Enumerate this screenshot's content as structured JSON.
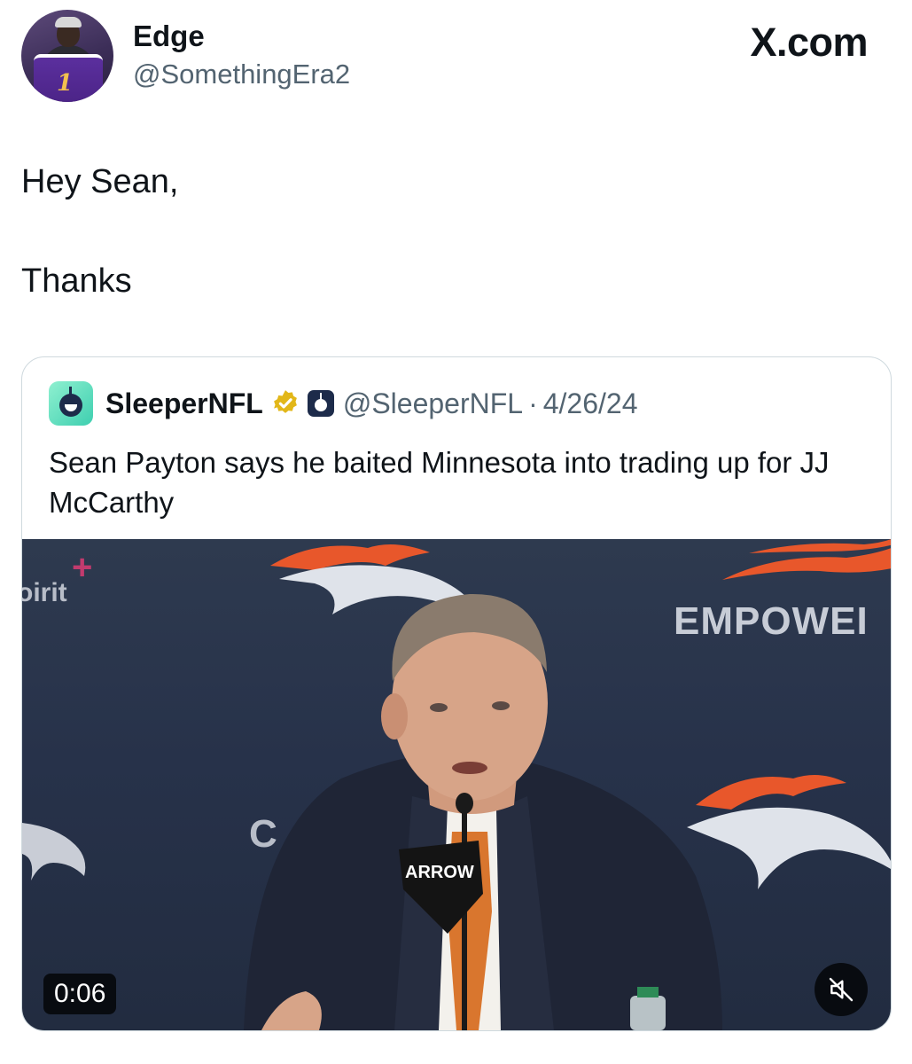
{
  "author": {
    "display_name": "Edge",
    "handle": "@SomethingEra2"
  },
  "brand": "X.com",
  "tweet": {
    "line1": "Hey Sean,",
    "line2": "Thanks"
  },
  "quoted": {
    "name": "SleeperNFL",
    "handle": "@SleeperNFL",
    "separator": "·",
    "date": "4/26/24",
    "text": "Sean Payton says he baited Minnesota into trading up for JJ McCarthy"
  },
  "media": {
    "duration": "0:06",
    "mute_icon": "speaker-muted-icon",
    "background_text": {
      "empower": "EMPOWEI",
      "sprint": "oirit",
      "c": "C",
      "mic_flag": "ARROW"
    }
  },
  "colors": {
    "text": "#0f1419",
    "secondary": "#536471",
    "border": "#cfd9de",
    "broncos_orange": "#e8572b",
    "verified_gold": "#e2b719"
  }
}
